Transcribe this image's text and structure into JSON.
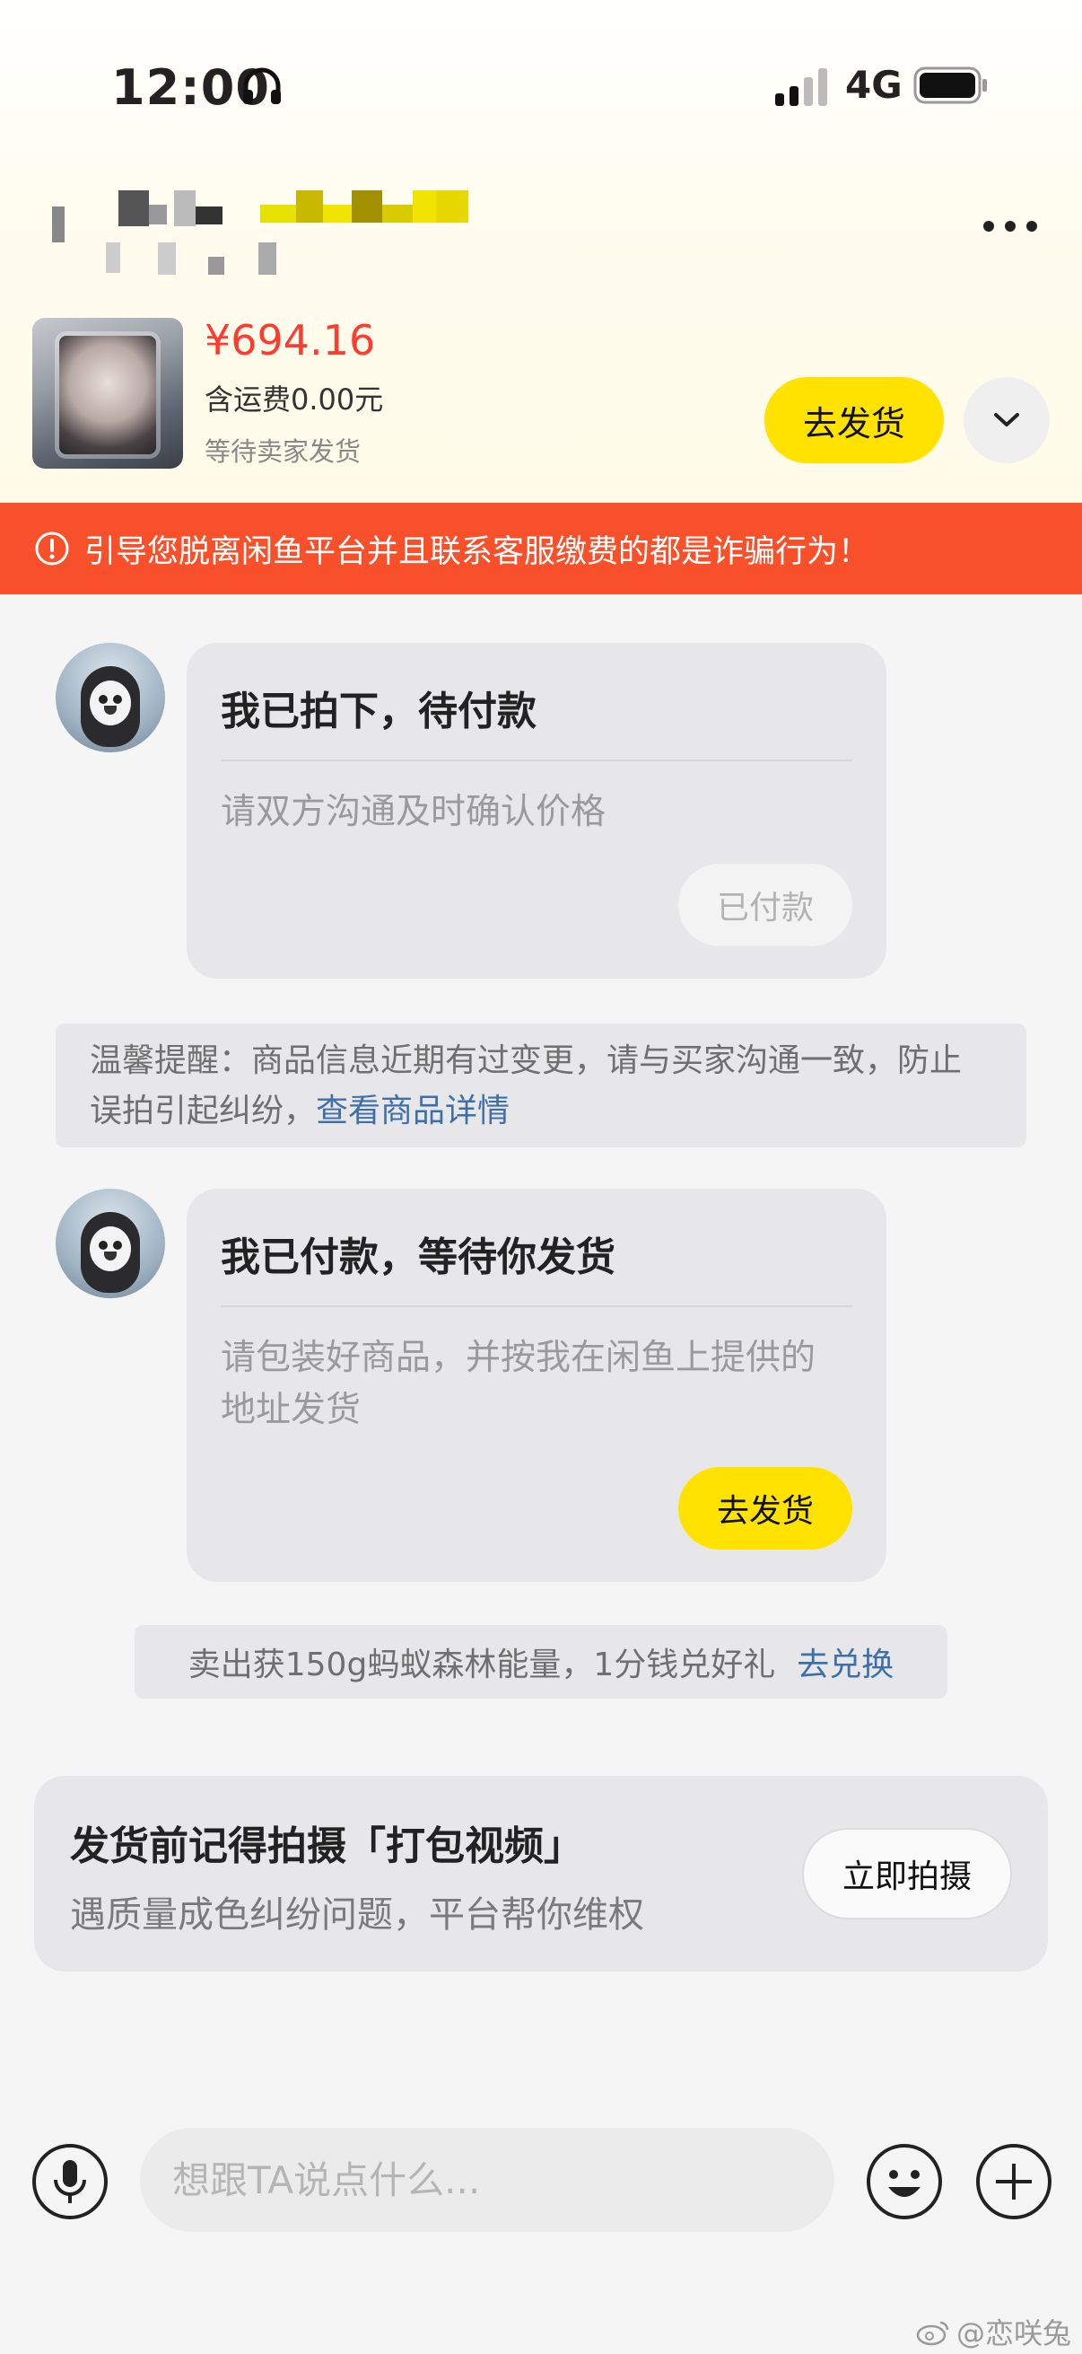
{
  "status_bar": {
    "time": "12:00",
    "network": "4G"
  },
  "product": {
    "price": "¥694.16",
    "shipping": "含运费0.00元",
    "status": "等待卖家发货",
    "ship_button": "去发货"
  },
  "banner": {
    "text": "引导您脱离闲鱼平台并且联系客服缴费的都是诈骗行为！"
  },
  "messages": [
    {
      "title": "我已拍下，待付款",
      "desc": "请双方沟通及时确认价格",
      "button": "已付款"
    },
    {
      "title": "我已付款，等待你发货",
      "desc": "请包装好商品，并按我在闲鱼上提供的地址发货",
      "button": "去发货"
    }
  ],
  "tip": {
    "text": "温馨提醒：商品信息近期有过变更，请与买家沟通一致，防止误拍引起纠纷，",
    "link": "查看商品详情"
  },
  "energy": {
    "text": "卖出获150g蚂蚁森林能量，1分钱兑好礼",
    "link": "去兑换"
  },
  "video_card": {
    "title": "发货前记得拍摄「打包视频」",
    "subtitle": "遇质量成色纠纷问题，平台帮你维权",
    "button": "立即拍摄"
  },
  "input": {
    "placeholder": "想跟TA说点什么..."
  },
  "watermark": {
    "text": "@恋咲兔"
  },
  "colors": {
    "accent_yellow": "#ffe200",
    "banner_red": "#f7502a",
    "price_red": "#ff3b2f",
    "link_blue": "#3f6fa8"
  }
}
